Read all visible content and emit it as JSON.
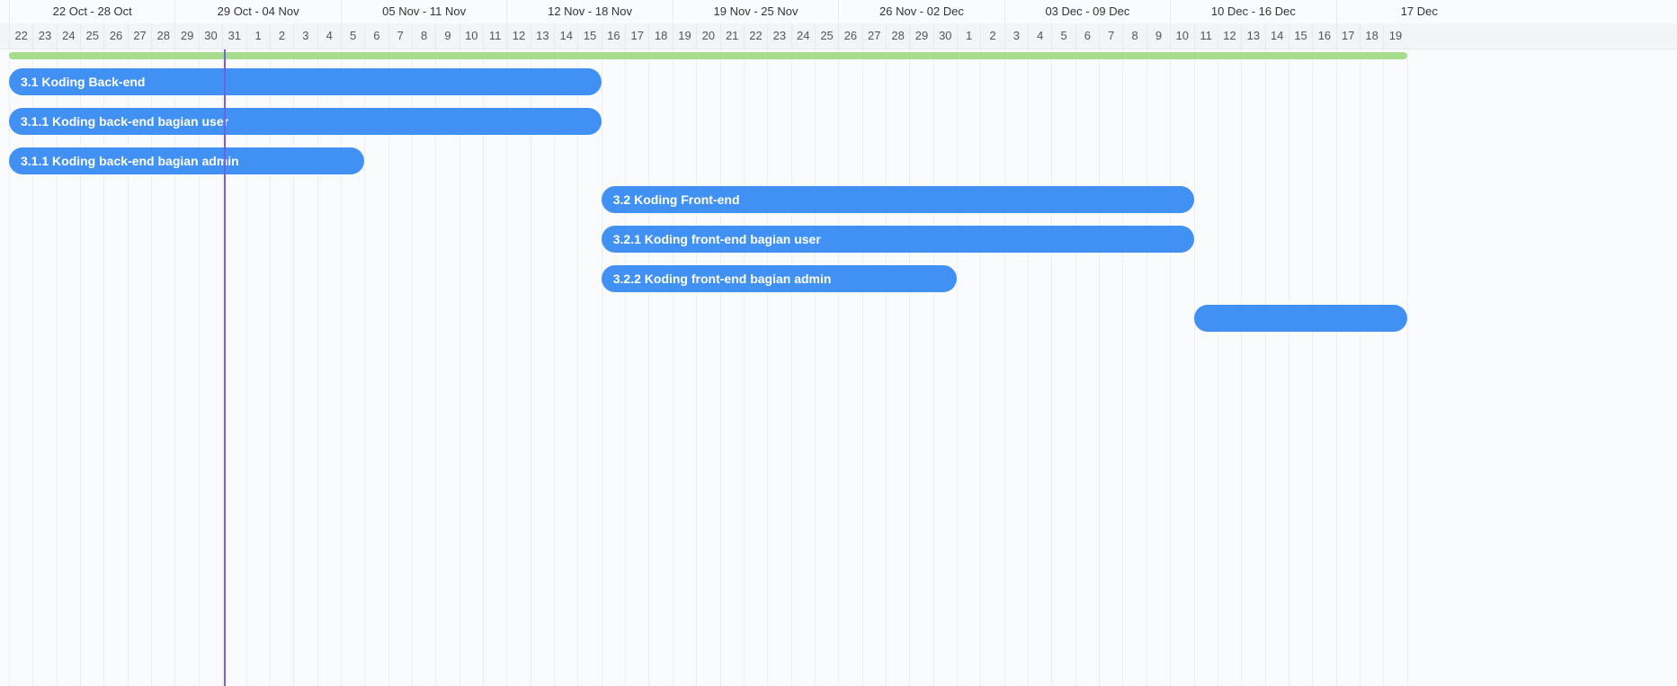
{
  "timeline": {
    "weeks": [
      {
        "label": "22 Oct - 28 Oct",
        "start_day_index": 0
      },
      {
        "label": "29 Oct - 04 Nov",
        "start_day_index": 7
      },
      {
        "label": "05 Nov - 11 Nov",
        "start_day_index": 14
      },
      {
        "label": "12 Nov - 18 Nov",
        "start_day_index": 21
      },
      {
        "label": "19 Nov - 25 Nov",
        "start_day_index": 28
      },
      {
        "label": "26 Nov - 02 Dec",
        "start_day_index": 35
      },
      {
        "label": "03 Dec - 09 Dec",
        "start_day_index": 42
      },
      {
        "label": "10 Dec - 16 Dec",
        "start_day_index": 49
      },
      {
        "label": "17 Dec",
        "start_day_index": 56
      }
    ],
    "days": [
      "22",
      "23",
      "24",
      "25",
      "26",
      "27",
      "28",
      "29",
      "30",
      "31",
      "1",
      "2",
      "3",
      "4",
      "5",
      "6",
      "7",
      "8",
      "9",
      "10",
      "11",
      "12",
      "13",
      "14",
      "15",
      "16",
      "17",
      "18",
      "19",
      "20",
      "21",
      "22",
      "23",
      "24",
      "25",
      "26",
      "27",
      "28",
      "29",
      "30",
      "1",
      "2",
      "3",
      "4",
      "5",
      "6",
      "7",
      "8",
      "9",
      "10",
      "11",
      "12",
      "13",
      "14",
      "15",
      "16",
      "17",
      "18",
      "19"
    ],
    "today_day_index": 9
  },
  "project": {
    "start_day_index": 0,
    "end_day_index": 59,
    "color": "#a6dd8d"
  },
  "tasks": [
    {
      "name": "3.1 Koding Back-end",
      "start_day_index": 0,
      "end_day_index": 25
    },
    {
      "name": "3.1.1 Koding back-end bagian user",
      "start_day_index": 0,
      "end_day_index": 25
    },
    {
      "name": "3.1.1 Koding back-end bagian admin",
      "start_day_index": 0,
      "end_day_index": 15
    },
    {
      "name": "3.2 Koding Front-end",
      "start_day_index": 25,
      "end_day_index": 50
    },
    {
      "name": "3.2.1 Koding front-end bagian user",
      "start_day_index": 25,
      "end_day_index": 50
    },
    {
      "name": "3.2.2 Koding front-end bagian admin",
      "start_day_index": 25,
      "end_day_index": 40
    },
    {
      "name": "",
      "start_day_index": 50,
      "end_day_index": 59
    }
  ],
  "colors": {
    "task_bar": "#4191f4",
    "today_line": "#7b5ce0",
    "project_bar": "#a6dd8d"
  }
}
